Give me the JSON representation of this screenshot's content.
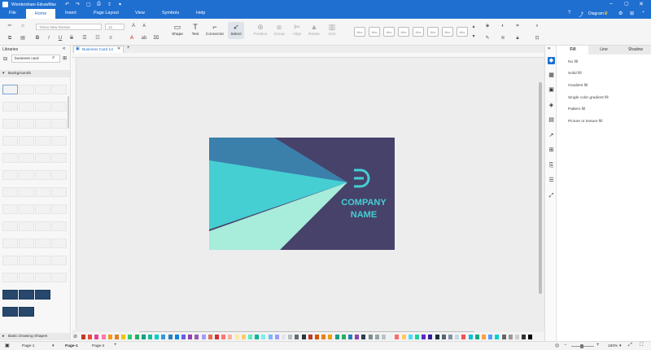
{
  "app": {
    "title": "Wondershare EdrawMax",
    "user_label": "Diagram"
  },
  "menu": {
    "items": [
      "File",
      "Home",
      "Insert",
      "Page Layout",
      "View",
      "Symbols",
      "Help"
    ],
    "active": "Home"
  },
  "ribbon": {
    "font_name": "Times New Roman",
    "font_size": "12",
    "tools": [
      "Shape",
      "Text",
      "Connector",
      "Select"
    ],
    "disabled_tools": [
      "Position",
      "Group",
      "Align",
      "Rotate",
      "Size"
    ],
    "style_label": "Abc"
  },
  "libraries": {
    "title": "Libraries",
    "search_value": "business card",
    "backgrounds_header": "Backgrounds",
    "basic_shapes_header": "Basic Drawing Shapes"
  },
  "tabs": {
    "document": "Business Card 14"
  },
  "card": {
    "company_line1": "COMPANY",
    "company_line2": "NAME",
    "colors": {
      "bg": "#46426a",
      "teal": "#45cfd3",
      "blue": "#3b80aa",
      "mint": "#a8ecdb"
    }
  },
  "right_panel": {
    "tabs": [
      "Fill",
      "Line",
      "Shadow"
    ],
    "active_tab": "Fill",
    "fill_options": [
      "No fill",
      "Solid fill",
      "Gradient fill",
      "Single color gradient fill",
      "Pattern fill",
      "Picture or texture fill"
    ]
  },
  "status": {
    "pages": [
      "Page-1",
      "Page-1",
      "Page-2"
    ],
    "zoom": "160%"
  },
  "palette": [
    "#c0392b",
    "#e74c3c",
    "#e84393",
    "#fd79a8",
    "#f39c12",
    "#e67e22",
    "#f1c40f",
    "#2ecc71",
    "#27ae60",
    "#16a085",
    "#1abc9c",
    "#00cec9",
    "#3498db",
    "#2980b9",
    "#0984e3",
    "#6c5ce7",
    "#8e44ad",
    "#9b59b6",
    "#a29bfe",
    "#e17055",
    "#d63031",
    "#ff7675",
    "#fab1a0",
    "#ffeaa7",
    "#fdcb6e",
    "#55efc4",
    "#00b894",
    "#81ecec",
    "#74b9ff",
    "#a29bfe",
    "#dfe6e9",
    "#b2bec3",
    "#636e72",
    "#2d3436",
    "#c0392b",
    "#d35400",
    "#e67e22",
    "#f39c12",
    "#16a085",
    "#27ae60",
    "#2980b9",
    "#8e44ad",
    "#2c3e50",
    "#7f8c8d",
    "#95a5a6",
    "#bdc3c7",
    "#ecf0f1",
    "#ff6b6b",
    "#feca57",
    "#48dbfb",
    "#1dd1a1",
    "#5f27cd",
    "#341f97",
    "#222f3e",
    "#576574",
    "#8395a7",
    "#c8d6e5",
    "#ee5253",
    "#0abde3",
    "#10ac84",
    "#ff9f43",
    "#54a0ff",
    "#00d2d3",
    "#666666",
    "#999999",
    "#cccccc",
    "#333333",
    "#000000"
  ]
}
